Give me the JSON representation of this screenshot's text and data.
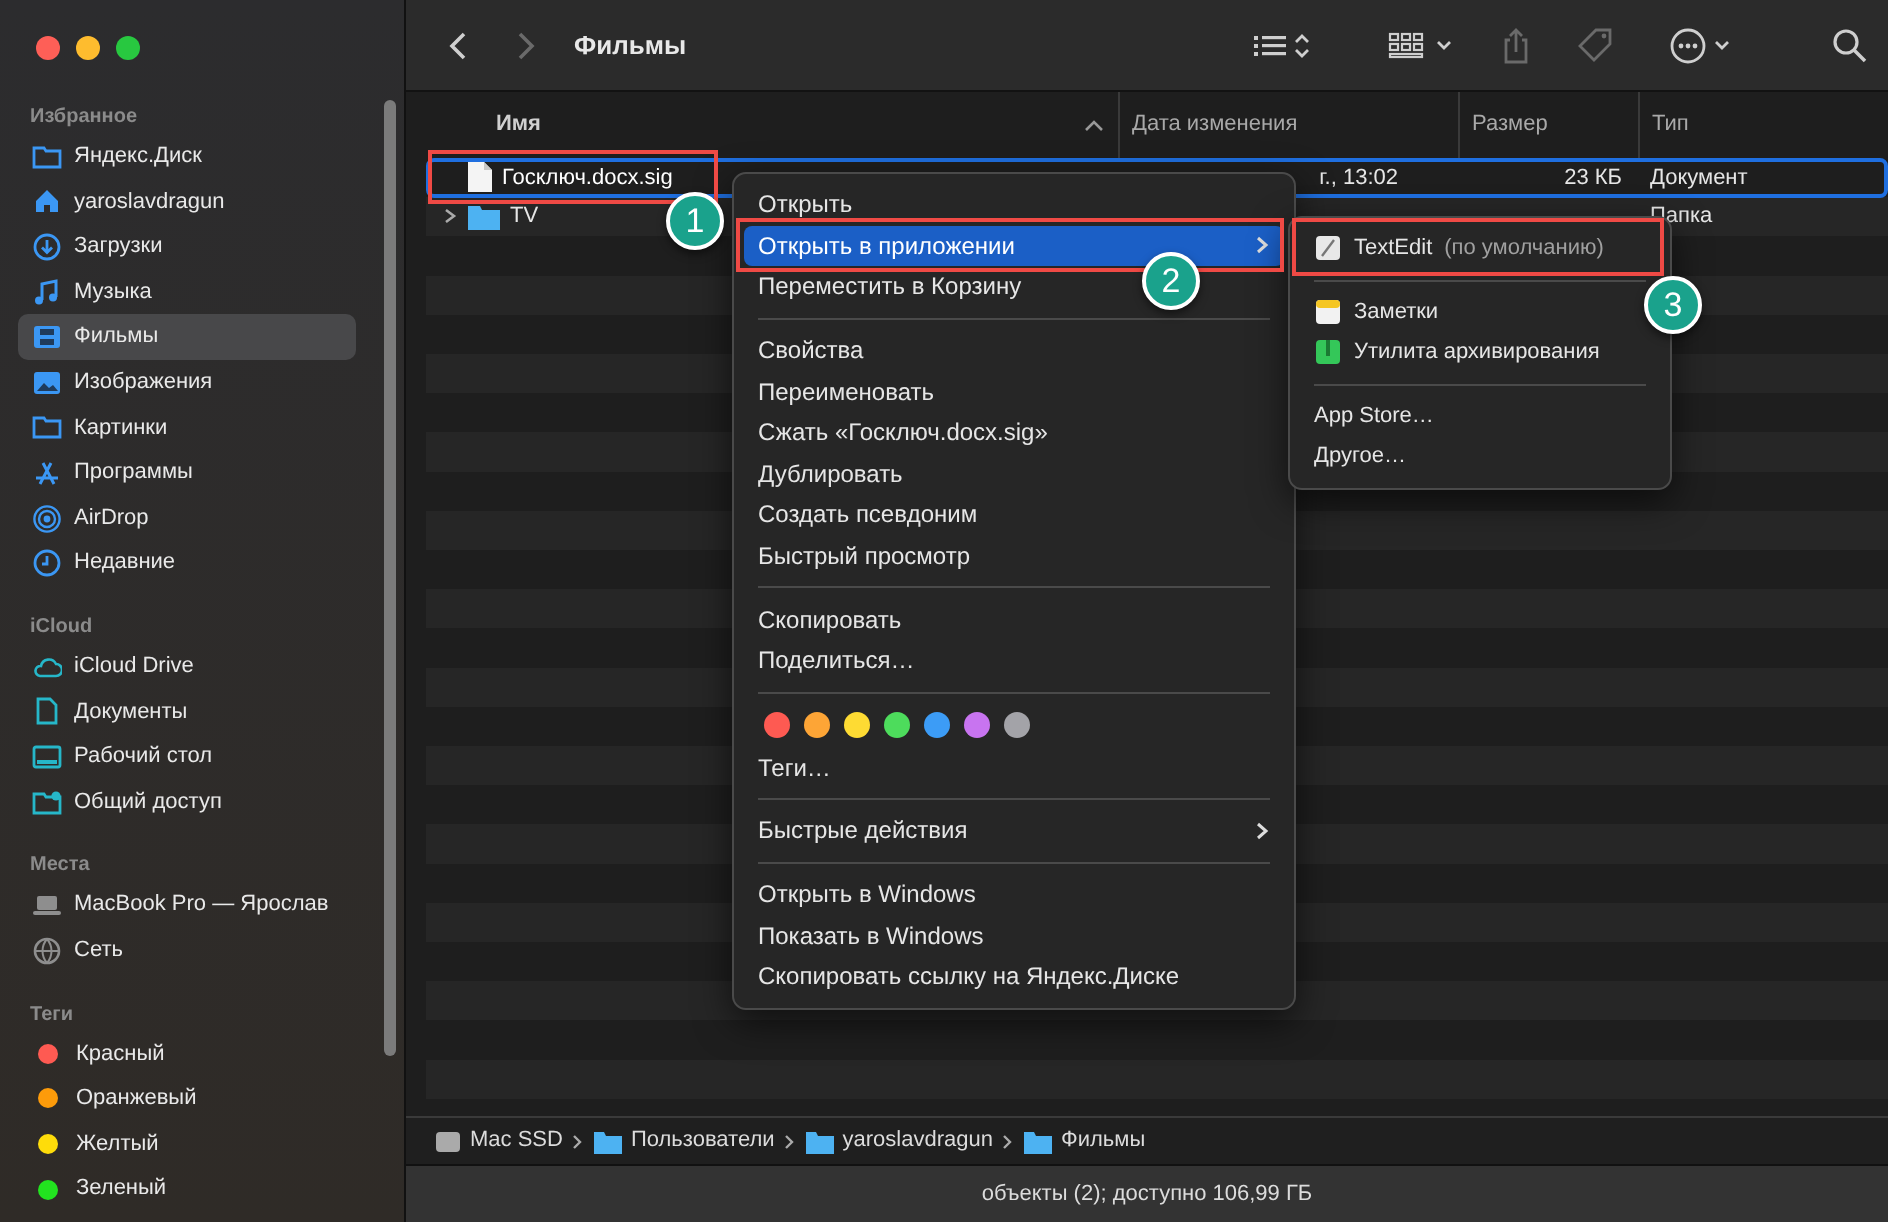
{
  "window": {
    "title": "Фильмы"
  },
  "sidebar": {
    "sections": [
      {
        "title": "Избранное",
        "items": [
          {
            "label": "Яндекс.Диск",
            "selected": false
          },
          {
            "label": "yaroslavdragun",
            "selected": false
          },
          {
            "label": "Загрузки",
            "selected": false
          },
          {
            "label": "Музыка",
            "selected": false
          },
          {
            "label": "Фильмы",
            "selected": true
          },
          {
            "label": "Изображения",
            "selected": false
          },
          {
            "label": "Картинки",
            "selected": false
          },
          {
            "label": "Программы",
            "selected": false
          },
          {
            "label": "AirDrop",
            "selected": false
          },
          {
            "label": "Недавние",
            "selected": false
          }
        ]
      },
      {
        "title": "iCloud",
        "items": [
          {
            "label": "iCloud Drive",
            "selected": false
          },
          {
            "label": "Документы",
            "selected": false
          },
          {
            "label": "Рабочий стол",
            "selected": false
          },
          {
            "label": "Общий доступ",
            "selected": false
          }
        ]
      },
      {
        "title": "Места",
        "items": [
          {
            "label": "MacBook Pro — Ярослав",
            "selected": false
          },
          {
            "label": "Сеть",
            "selected": false
          }
        ]
      },
      {
        "title": "Теги",
        "items": [
          {
            "label": "Красный",
            "selected": false,
            "color": "#fe5a52"
          },
          {
            "label": "Оранжевый",
            "selected": false,
            "color": "#fd9b0a"
          },
          {
            "label": "Желтый",
            "selected": false,
            "color": "#fedc0a"
          },
          {
            "label": "Зеленый",
            "selected": false,
            "color": "#22e31f"
          }
        ]
      }
    ]
  },
  "table": {
    "columns": [
      "Имя",
      "Дата изменения",
      "Размер",
      "Тип"
    ],
    "rows": [
      {
        "name": "Госключ.docx.sig",
        "kind": "file",
        "date": "г., 13:02",
        "size": "23 КБ",
        "type": "Документ",
        "selected": true
      },
      {
        "name": "TV",
        "kind": "folder",
        "date": "",
        "size": "",
        "type": "Папка",
        "selected": false
      }
    ]
  },
  "context_menu": [
    {
      "kind": "item",
      "label": "Открыть",
      "selected": false
    },
    {
      "kind": "submenu",
      "label": "Открыть в приложении",
      "selected": true
    },
    {
      "kind": "item",
      "label": "Переместить в Корзину",
      "selected": false
    },
    {
      "kind": "separator"
    },
    {
      "kind": "item",
      "label": "Свойства",
      "selected": false
    },
    {
      "kind": "item",
      "label": "Переименовать",
      "selected": false
    },
    {
      "kind": "item",
      "label": "Сжать «Госключ.docx.sig»",
      "selected": false
    },
    {
      "kind": "item",
      "label": "Дублировать",
      "selected": false
    },
    {
      "kind": "item",
      "label": "Создать псевдоним",
      "selected": false
    },
    {
      "kind": "item",
      "label": "Быстрый просмотр",
      "selected": false
    },
    {
      "kind": "separator"
    },
    {
      "kind": "item",
      "label": "Скопировать",
      "selected": false
    },
    {
      "kind": "item",
      "label": "Поделиться…",
      "selected": false
    },
    {
      "kind": "separator"
    },
    {
      "kind": "tags",
      "tags": [
        {
          "color": "#fe5a52"
        },
        {
          "color": "#fda536"
        },
        {
          "color": "#fedb33"
        },
        {
          "color": "#4ddc5c"
        },
        {
          "color": "#3c9cf6"
        },
        {
          "color": "#c874f0"
        },
        {
          "color": "#a3a3a8"
        }
      ]
    },
    {
      "kind": "item",
      "label": "Теги…",
      "selected": false
    },
    {
      "kind": "separator"
    },
    {
      "kind": "submenu",
      "label": "Быстрые действия",
      "selected": false
    },
    {
      "kind": "separator"
    },
    {
      "kind": "item",
      "label": "Открыть в Windows",
      "selected": false
    },
    {
      "kind": "item",
      "label": "Показать в Windows",
      "selected": false
    },
    {
      "kind": "item",
      "label": "Скопировать ссылку на Яндекс.Диске",
      "selected": false
    }
  ],
  "submenu": [
    {
      "kind": "app",
      "label": "TextEdit",
      "note": "(по умолчанию)"
    },
    {
      "kind": "separator"
    },
    {
      "kind": "app",
      "label": "Заметки"
    },
    {
      "kind": "app",
      "label": "Утилита архивирования"
    },
    {
      "kind": "separator"
    },
    {
      "kind": "item",
      "label": "App Store…"
    },
    {
      "kind": "item",
      "label": "Другое…"
    }
  ],
  "path_bar": [
    "Mac SSD",
    "Пользователи",
    "yaroslavdragun",
    "Фильмы"
  ],
  "status_bar": "объекты (2); доступно 106,99 ГБ",
  "annotations": [
    "1",
    "2",
    "3"
  ]
}
